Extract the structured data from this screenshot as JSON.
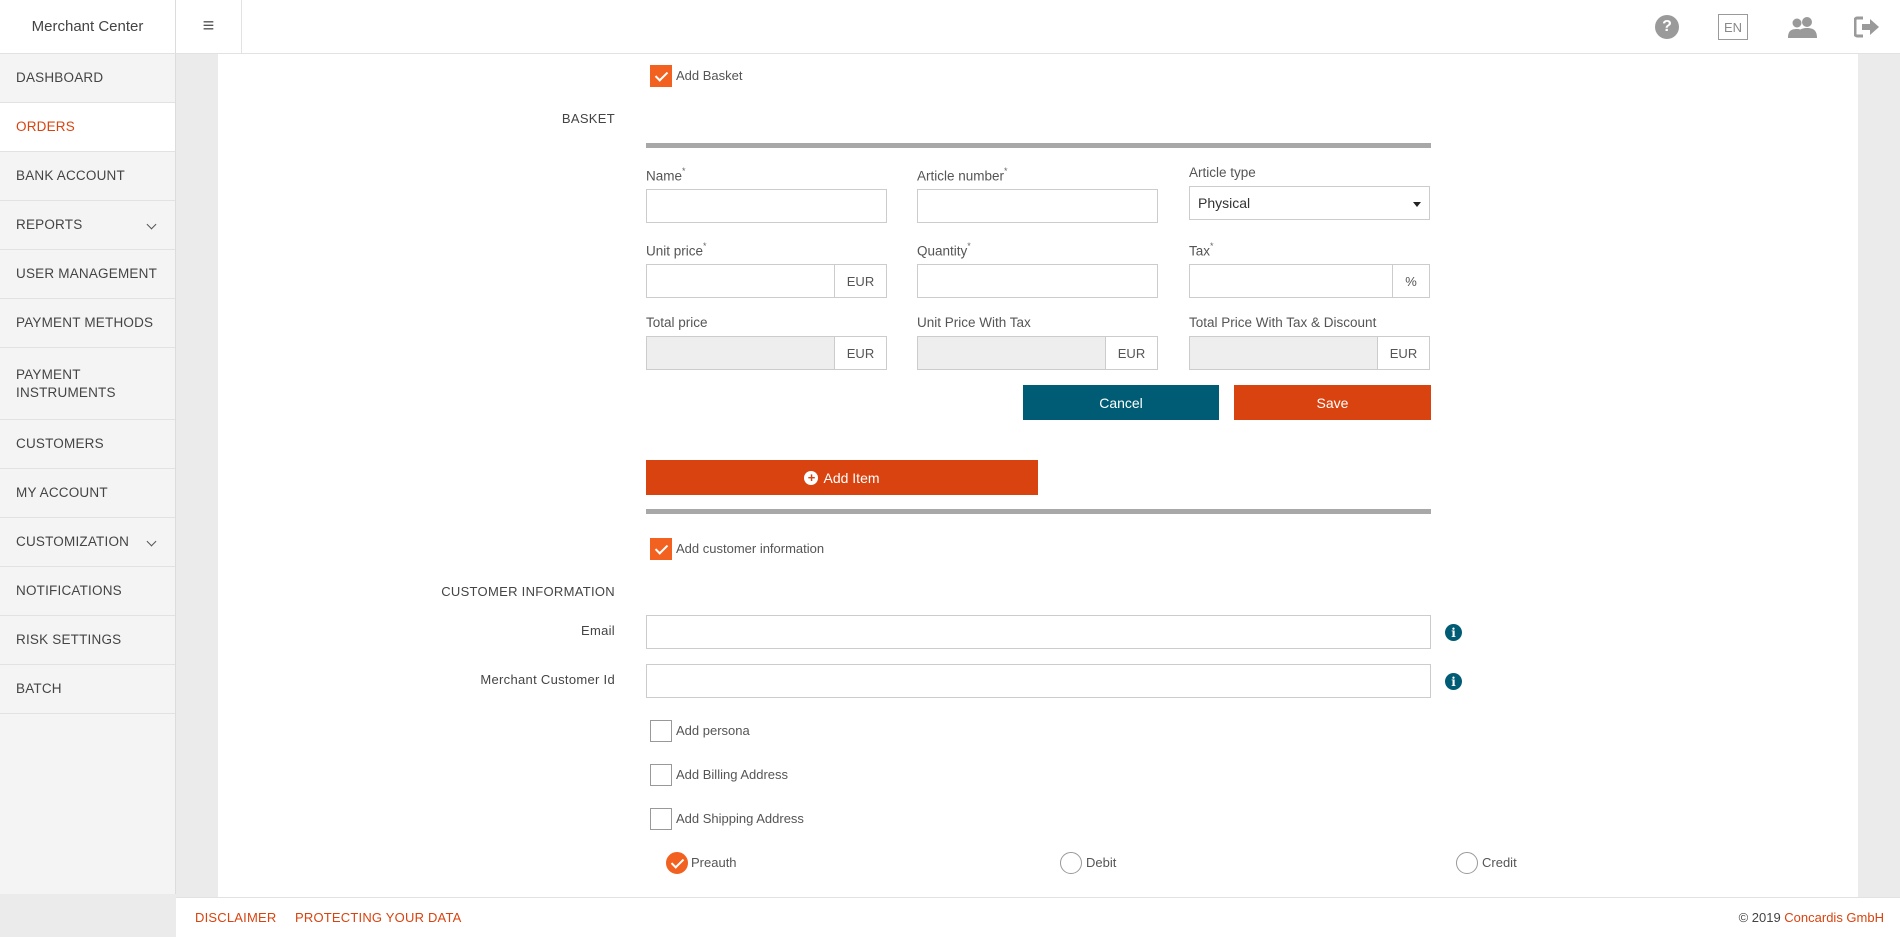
{
  "header": {
    "brand": "Merchant Center",
    "menu_icon": "≡",
    "language": "EN"
  },
  "sidebar": {
    "items": [
      {
        "label": "DASHBOARD"
      },
      {
        "label": "ORDERS"
      },
      {
        "label": "BANK ACCOUNT"
      },
      {
        "label": "REPORTS"
      },
      {
        "label": "USER MANAGEMENT"
      },
      {
        "label": "PAYMENT METHODS"
      },
      {
        "label": "PAYMENT INSTRUMENTS"
      },
      {
        "label": "CUSTOMERS"
      },
      {
        "label": "MY ACCOUNT"
      },
      {
        "label": "CUSTOMIZATION"
      },
      {
        "label": "NOTIFICATIONS"
      },
      {
        "label": "RISK SETTINGS"
      },
      {
        "label": "BATCH"
      }
    ]
  },
  "basket": {
    "add_basket_label": "Add Basket",
    "section_title": "BASKET",
    "fields": {
      "name": "Name",
      "article_number": "Article number",
      "article_type": "Article type",
      "article_type_value": "Physical",
      "unit_price": "Unit price",
      "quantity": "Quantity",
      "tax": "Tax",
      "total_price": "Total price",
      "unit_price_with_tax": "Unit Price With Tax",
      "total_price_with_tax_discount": "Total Price With Tax & Discount",
      "currency": "EUR",
      "percent": "%",
      "required_mark": "*"
    },
    "cancel_label": "Cancel",
    "save_label": "Save",
    "add_item_label": "Add Item"
  },
  "customer": {
    "add_customer_label": "Add customer information",
    "section_title": "CUSTOMER INFORMATION",
    "email_label": "Email",
    "merchant_id_label": "Merchant Customer Id",
    "add_persona_label": "Add persona",
    "add_billing_label": "Add Billing Address",
    "add_shipping_label": "Add Shipping Address",
    "info_glyph": "i"
  },
  "transaction_type": {
    "preauth": "Preauth",
    "debit": "Debit",
    "credit": "Credit"
  },
  "footer": {
    "disclaimer": "DISCLAIMER",
    "protecting": "PROTECTING YOUR DATA",
    "copyright_prefix": "© 2019 ",
    "company": "Concardis GmbH"
  },
  "colors": {
    "accent": "#d9430f",
    "checkbox": "#f2611f",
    "cancel": "#005c75",
    "info": "#005c75"
  }
}
